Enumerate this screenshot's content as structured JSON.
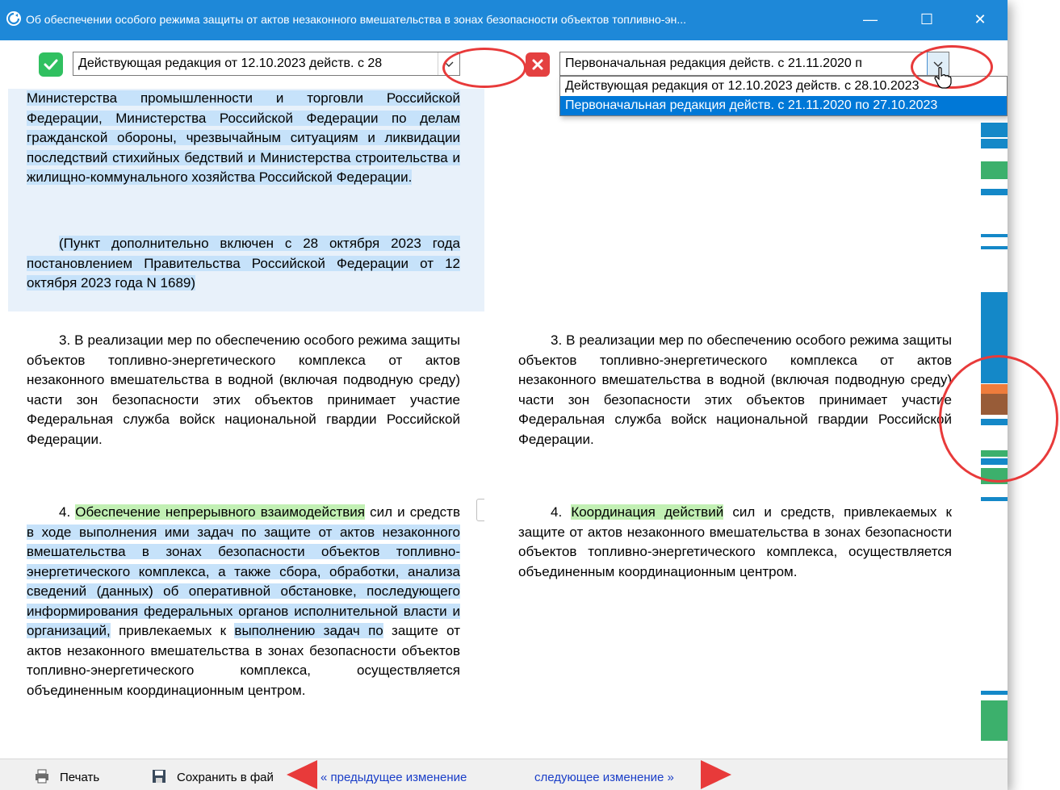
{
  "window": {
    "title": "Об обеспечении особого режима защиты от актов незаконного вмешательства в зонах безопасности объектов топливно-эн...",
    "minimize": "—",
    "maximize": "☐",
    "close": "✕"
  },
  "left": {
    "version_label": "Действующая редакция от 12.10.2023 действ. с 28"
  },
  "right": {
    "version_label": "Первоначальная редакция действ. с 21.11.2020 п"
  },
  "dropdown": {
    "options": [
      "Действующая редакция от 12.10.2023 действ. с 28.10.2023",
      "Первоначальная редакция действ. с 21.11.2020 по 27.10.2023"
    ],
    "selected_index": 1
  },
  "content": {
    "left_changed_block": "Министерства промышленности и торговли Российской Федерации, Министерства Российской Федерации по делам гражданской обороны, чрезвычайным ситуациям и ликвидации последствий стихийных бедствий и Министерства строительства и жилищно-коммунального хозяйства Российской Федерации.",
    "left_note": "(Пункт дополнительно включен с 28 октября 2023 года постановлением Правительства Российской Федерации от 12 октября 2023 года N 1689)",
    "left_p3": "3. В реализации мер по обеспечению особого режима защиты объектов топливно-энергетического комплекса от актов незаконного вмешательства в водной (включая подводную среду) части зон безопасности этих объектов принимает участие Федеральная служба войск национальной гвардии Российской Федерации.",
    "right_p3": "3. В реализации мер по обеспечению особого режима защиты объектов топливно-энергетического комплекса от актов незаконного вмешательства в водной (включая подводную среду) части зон безопасности этих объектов принимает участие Федеральная служба войск национальной гвардии Российской Федерации.",
    "left_p4": {
      "num": "4. ",
      "green": "Обеспечение непрерывного взаимодействия",
      "t1": " сил и средств ",
      "blue": "в ходе выполнения ими задач по защите от актов незаконного вмешательства в зонах безопасности объектов топливно-энергетического комплекса, а также сбора, обработки, анализа сведений (данных) об оперативной обстановке, последующего информирования федеральных органов исполнительной власти и организаций,",
      "t2": " привлекаемых к ",
      "blue2": "выполнению задач по",
      "t3": " защите от актов незаконного вмешательства в зонах безопасности объектов топливно-энергетического комплекса, осуществляется объединенным координационным центром."
    },
    "right_p4": {
      "num": "4. ",
      "green": "Координация действий",
      "rest": " сил и средств, привлекаемых к защите от актов незаконного вмешательства в зонах безопасности объектов топливно-энергетического комплекса, осуществляется объединенным координационным центром."
    }
  },
  "statusbar": {
    "print": "Печать",
    "save": "Сохранить в фай",
    "prev": "« предыдущее изменение",
    "next": "следующее изменение »"
  },
  "colors": {
    "titlebar": "#1e88d8",
    "changed_highlight": "#c6e2fa",
    "inserted_highlight": "#c2f0b4",
    "annotation": "#e83a3a",
    "link": "#1a3ec8"
  }
}
